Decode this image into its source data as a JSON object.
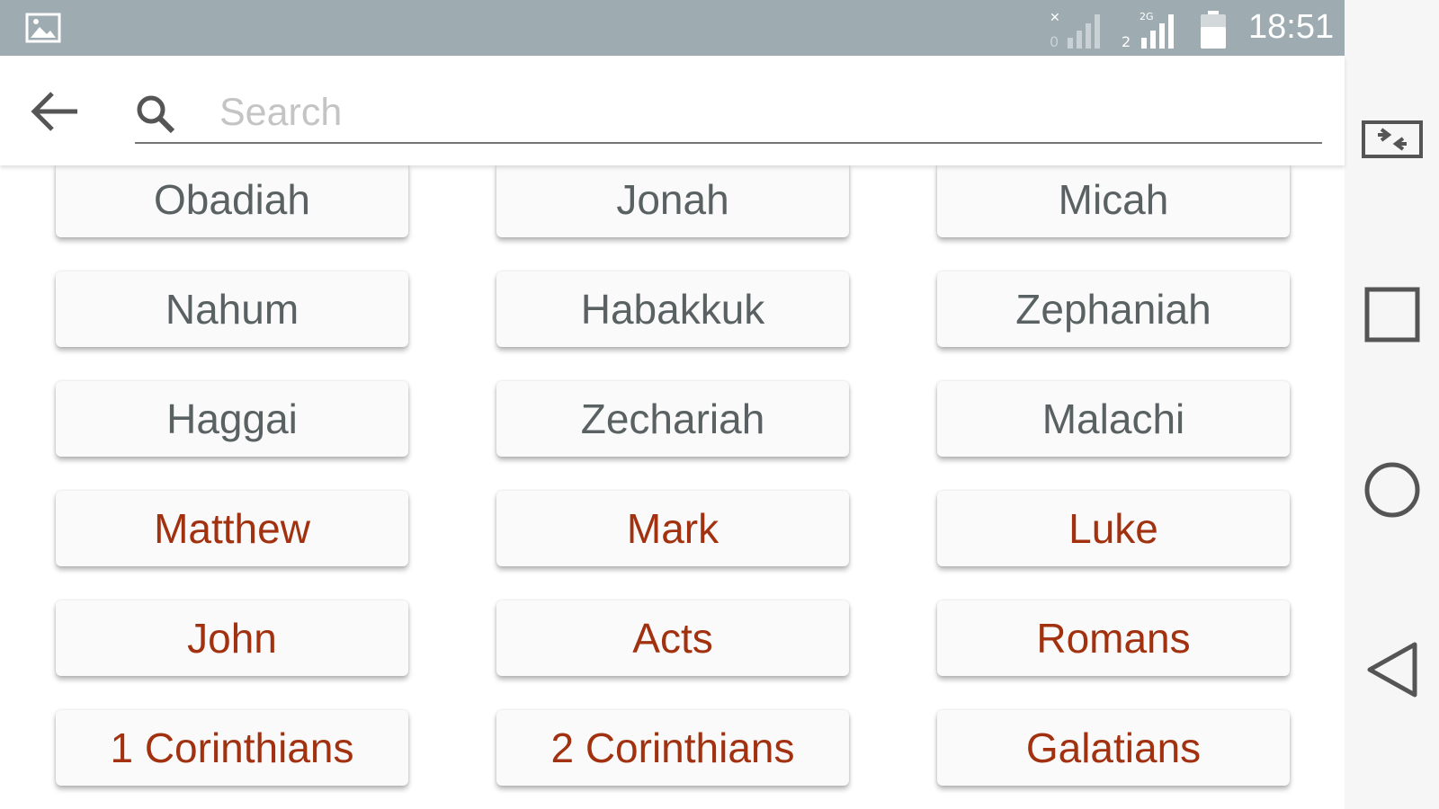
{
  "status_bar": {
    "time": "18:51",
    "icons": [
      "gallery-icon",
      "signal-icon-sim1",
      "signal-icon-sim2",
      "battery-icon"
    ]
  },
  "search": {
    "placeholder": "Search",
    "value": ""
  },
  "colors": {
    "old_testament_text": "#5a6163",
    "new_testament_text": "#a1310f",
    "status_bar_bg": "#9eabb0"
  },
  "books": [
    {
      "name": "Obadiah",
      "testament": "ot"
    },
    {
      "name": "Jonah",
      "testament": "ot"
    },
    {
      "name": "Micah",
      "testament": "ot"
    },
    {
      "name": "Nahum",
      "testament": "ot"
    },
    {
      "name": "Habakkuk",
      "testament": "ot"
    },
    {
      "name": "Zephaniah",
      "testament": "ot"
    },
    {
      "name": "Haggai",
      "testament": "ot"
    },
    {
      "name": "Zechariah",
      "testament": "ot"
    },
    {
      "name": "Malachi",
      "testament": "ot"
    },
    {
      "name": "Matthew",
      "testament": "nt"
    },
    {
      "name": "Mark",
      "testament": "nt"
    },
    {
      "name": "Luke",
      "testament": "nt"
    },
    {
      "name": "John",
      "testament": "nt"
    },
    {
      "name": "Acts",
      "testament": "nt"
    },
    {
      "name": "Romans",
      "testament": "nt"
    },
    {
      "name": "1 Corinthians",
      "testament": "nt"
    },
    {
      "name": "2 Corinthians",
      "testament": "nt"
    },
    {
      "name": "Galatians",
      "testament": "nt"
    }
  ],
  "nav_bar": {
    "icons": [
      "switch-app-icon",
      "recents-icon",
      "home-icon",
      "back-nav-icon"
    ]
  }
}
